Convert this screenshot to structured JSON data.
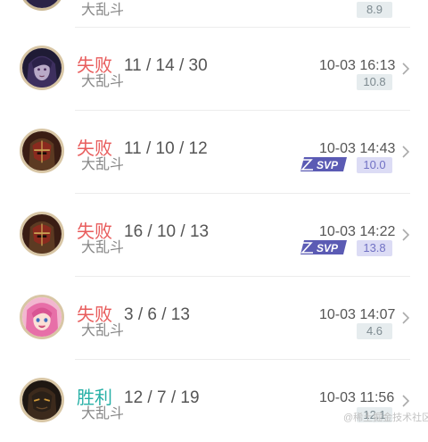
{
  "list": {
    "top_partial": {
      "mode": "大乱斗",
      "score": "8.9"
    },
    "matches": [
      {
        "result": "失败",
        "kda": "11 / 14 / 30",
        "time": "10-03 16:13",
        "mode": "大乱斗",
        "score": "10.8",
        "svp": false,
        "avatar_icon": "champion-avatar-purple-hair"
      },
      {
        "result": "失败",
        "kda": "11 / 10 / 12",
        "time": "10-03 14:43",
        "mode": "大乱斗",
        "score": "10.0",
        "svp": true,
        "svp_label": "SVP",
        "avatar_icon": "champion-avatar-red-mask"
      },
      {
        "result": "失败",
        "kda": "16 / 10 / 13",
        "time": "10-03 14:22",
        "mode": "大乱斗",
        "score": "13.8",
        "svp": true,
        "svp_label": "SVP",
        "avatar_icon": "champion-avatar-red-mask"
      },
      {
        "result": "失败",
        "kda": "3 / 6 / 13",
        "time": "10-03 14:07",
        "mode": "大乱斗",
        "score": "4.6",
        "svp": false,
        "avatar_icon": "champion-avatar-pink-hair"
      },
      {
        "result": "胜利",
        "kda": "12 / 7 / 19",
        "time": "10-03 11:56",
        "mode": "大乱斗",
        "score": "12.1",
        "svp": false,
        "avatar_icon": "champion-avatar-dark-mask"
      }
    ]
  },
  "watermark": "@稀土掘金技术社区",
  "colors": {
    "lose": "#e85c5c",
    "win": "#27b0a6",
    "score_bg": "#e6ecee",
    "svp_score_bg": "#dcdcf5",
    "svp_badge": "#5b5bb4"
  }
}
